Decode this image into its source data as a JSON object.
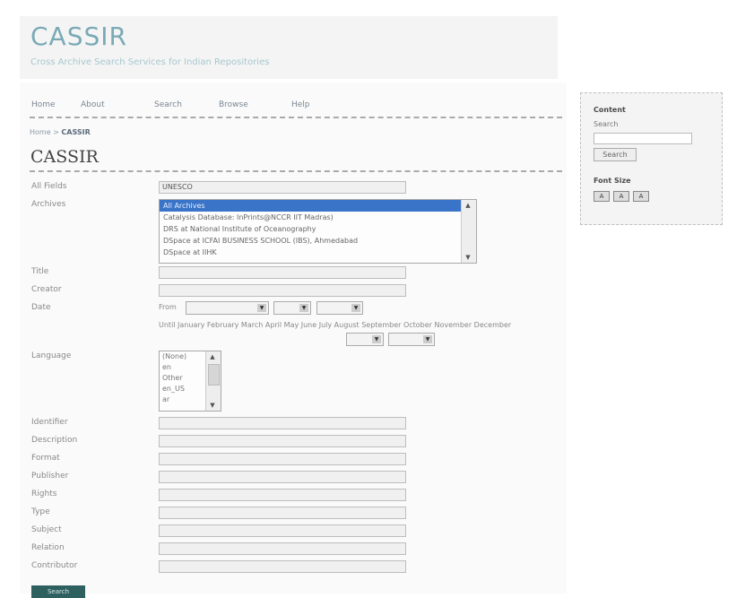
{
  "header": {
    "title": "CASSIR",
    "subtitle": "Cross Archive Search Services for Indian Repositories"
  },
  "nav": [
    "Home",
    "About",
    "Search",
    "Browse",
    "Help"
  ],
  "breadcrumb": {
    "home": "Home",
    "sep": " > ",
    "current": "CASSIR"
  },
  "page_title": "CASSIR",
  "form": {
    "all_fields": {
      "label": "All Fields",
      "value": "UNESCO"
    },
    "archives": {
      "label": "Archives",
      "options": [
        "All Archives",
        "Catalysis Database: InPrints@NCCR IIT Madras)",
        "DRS at National Institute of Oceanography",
        "DSpace at ICFAI BUSINESS SCHOOL (IBS), Ahmedabad",
        "DSpace at IIHK"
      ],
      "selected_index": 0
    },
    "title_label": "Title",
    "creator_label": "Creator",
    "date": {
      "label": "Date",
      "from_label": "From",
      "until_text": "Until January February March April May June July August September October November December"
    },
    "language": {
      "label": "Language",
      "options": [
        "(None)",
        "en",
        "Other",
        "en_US",
        "ar"
      ]
    },
    "fields": [
      "Identifier",
      "Description",
      "Format",
      "Publisher",
      "Rights",
      "Type",
      "Subject",
      "Relation",
      "Contributor"
    ],
    "submit_label": "Search"
  },
  "sidebar": {
    "content_title": "Content",
    "search_label": "Search",
    "search_button": "Search",
    "font_size_label": "Font Size",
    "font_buttons": [
      "A",
      "A",
      "A"
    ]
  }
}
